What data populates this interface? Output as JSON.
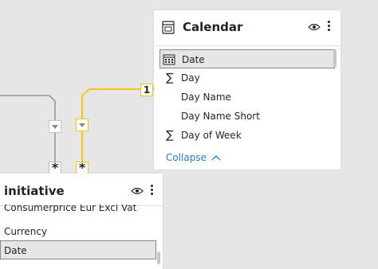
{
  "calendar_table": {
    "title": "Calendar",
    "fields": [
      {
        "label": "Date",
        "type": "calendar",
        "selected": true
      },
      {
        "label": "Day",
        "type": "sum",
        "selected": false
      },
      {
        "label": "Day Name",
        "type": "text",
        "selected": false
      },
      {
        "label": "Day Name Short",
        "type": "text",
        "selected": false
      },
      {
        "label": "Day of Week",
        "type": "sum",
        "selected": false
      }
    ],
    "collapse_label": "Collapse",
    "icon": "table-icon"
  },
  "initiative_table": {
    "title": "initiative",
    "fields": [
      {
        "label": "Consumerprice Eur Excl Vat",
        "type": "text",
        "selected": false
      },
      {
        "label": "Currency",
        "type": "text",
        "selected": false
      },
      {
        "label": "Date",
        "type": "text",
        "selected": true
      }
    ]
  },
  "relationships": [
    {
      "from_cardinality": "*",
      "to_cardinality": "1",
      "color": "#f2c811",
      "active": true
    },
    {
      "from_cardinality": "*",
      "to_cardinality": "",
      "color": "#9a9a9a",
      "active": false
    }
  ],
  "colors": {
    "canvas": "#e6e6e6",
    "card": "#ffffff",
    "accent_link": "#2b7cd3",
    "active_relationship": "#f2c811"
  }
}
